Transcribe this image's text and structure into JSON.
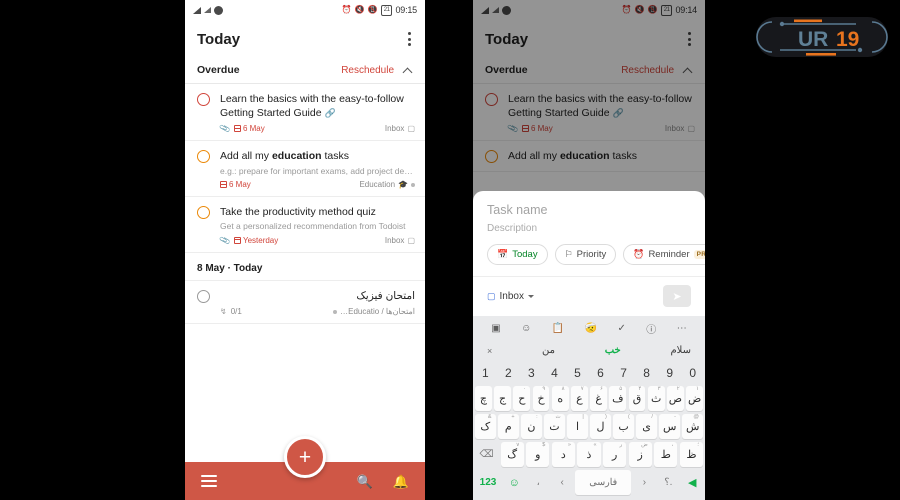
{
  "left_phone": {
    "statusbar": {
      "clock": "09:15",
      "icons": [
        "signal-icon",
        "signal-icon",
        "do-not-disturb-icon",
        "alarm-icon",
        "sound-off-icon",
        "vibrate-icon",
        "battery-icon"
      ],
      "battery_label": "21"
    },
    "header": {
      "title": "Today",
      "menu": "overflow-menu-icon"
    },
    "overdue_section": {
      "title": "Overdue",
      "action": "Reschedule",
      "collapse": "chevron-up-icon"
    },
    "tasks": [
      {
        "title": "Learn the basics with the easy-to-follow Getting Started Guide",
        "has_link": true,
        "description": "",
        "attachment": "paperclip-icon",
        "date": "6 May",
        "project": "Inbox",
        "priority": "p1"
      },
      {
        "title_prefix": "Add all my ",
        "title_bold": "education",
        "title_suffix": " tasks",
        "description": "e.g.: prepare for important exams, add project de…",
        "date": "6 May",
        "project": "Education",
        "project_emoji": "🎓",
        "priority": "p3"
      },
      {
        "title": "Take the productivity method quiz",
        "description": "Get a personalized recommendation from Todoist",
        "attachment": "paperclip-icon",
        "date": "Yesterday",
        "project": "Inbox",
        "priority": "p3"
      }
    ],
    "date_divider": "8 May · Today",
    "today_tasks": [
      {
        "title": "امتحان فیزیک",
        "subtasks": "0/1",
        "project": "امتحان‌ها / Educatio…",
        "priority": "none"
      }
    ],
    "bottom_nav": {
      "menu": "hamburger-icon",
      "add": "+",
      "search": "search-icon",
      "notifications": "bell-icon"
    }
  },
  "right_phone": {
    "statusbar": {
      "clock": "09:14",
      "battery_label": "21"
    },
    "header": {
      "title": "Today",
      "menu": "overflow-menu-icon"
    },
    "overdue_section": {
      "title": "Overdue",
      "action": "Reschedule",
      "collapse": "chevron-up-icon"
    },
    "background_tasks": [
      {
        "title": "Learn the basics with the easy-to-follow Getting Started Guide",
        "date": "6 May",
        "project": "Inbox",
        "priority": "p1"
      },
      {
        "title_prefix": "Add all my ",
        "title_bold": "education",
        "title_suffix": " tasks",
        "priority": "p3"
      }
    ],
    "quick_add": {
      "name_placeholder": "Task name",
      "description_placeholder": "Description",
      "chips": [
        {
          "label": "Today",
          "icon": "calendar-icon",
          "badge": ""
        },
        {
          "label": "Priority",
          "icon": "flag-icon",
          "badge": ""
        },
        {
          "label": "Reminder",
          "icon": "alarm-clock-icon",
          "badge": "PRO"
        }
      ],
      "project_selector": {
        "label": "Inbox",
        "icon": "inbox-icon",
        "caret": "chevron-down-icon"
      },
      "send": "send-icon"
    },
    "keyboard": {
      "toolbar": [
        "gif-icon",
        "sticker-icon",
        "clipboard-icon",
        "translate-icon",
        "handwriting-icon",
        "info-icon",
        "more-icon"
      ],
      "suggestions": [
        "سلام",
        "خب",
        "من"
      ],
      "suggestion_highlighted": "خب",
      "close_suggestions": "×",
      "number_row": [
        "1",
        "2",
        "3",
        "4",
        "5",
        "6",
        "7",
        "8",
        "9",
        "0"
      ],
      "row1": [
        {
          "k": "ض",
          "s": "۱"
        },
        {
          "k": "ص",
          "s": "۲"
        },
        {
          "k": "ث",
          "s": "۳"
        },
        {
          "k": "ق",
          "s": "۴"
        },
        {
          "k": "ف",
          "s": "۵"
        },
        {
          "k": "غ",
          "s": "۶"
        },
        {
          "k": "ع",
          "s": "۷"
        },
        {
          "k": "ه",
          "s": "۸"
        },
        {
          "k": "خ",
          "s": "۹"
        },
        {
          "k": "ح",
          "s": "۰"
        },
        {
          "k": "ج",
          "s": ""
        },
        {
          "k": "چ",
          "s": ""
        }
      ],
      "row2": [
        {
          "k": "ش",
          "s": "@"
        },
        {
          "k": "س",
          "s": "-"
        },
        {
          "k": "ی",
          "s": "/"
        },
        {
          "k": "ب",
          "s": "("
        },
        {
          "k": "ل",
          "s": ")"
        },
        {
          "k": "ا",
          "s": "|"
        },
        {
          "k": "ت",
          "s": "ث"
        },
        {
          "k": "ن",
          "s": ":"
        },
        {
          "k": "م",
          "s": "+"
        },
        {
          "k": "ک",
          "s": "&"
        }
      ],
      "row3": [
        {
          "k": "ظ",
          "s": "؛"
        },
        {
          "k": "ط",
          "s": "،"
        },
        {
          "k": "ز",
          "s": "ض"
        },
        {
          "k": "ر",
          "s": "ر"
        },
        {
          "k": "ذ",
          "s": "«"
        },
        {
          "k": "د",
          "s": "»"
        },
        {
          "k": "و",
          "s": "$"
        },
        {
          "k": "گ",
          "s": "∨"
        }
      ],
      "backspace": "backspace-icon",
      "shift": "⌃",
      "bottom_row": {
        "numbers": "123",
        "emoji": "emoji-icon",
        "comma": "،",
        "left_arrow": "‹",
        "space_label": "فارسی",
        "right_arrow": "›",
        "period": "؟.",
        "send": "send-arrow-icon"
      }
    }
  },
  "watermark": {
    "text_primary": "UR",
    "text_accent": "19",
    "name": "ur19-logo"
  },
  "colors": {
    "accent_red": "#d1453b",
    "nav_red": "#cf5746",
    "priority_orange": "#eb8909",
    "green": "#11b14b",
    "logo_orange": "#e8741e",
    "logo_slate": "#5a7a92"
  }
}
